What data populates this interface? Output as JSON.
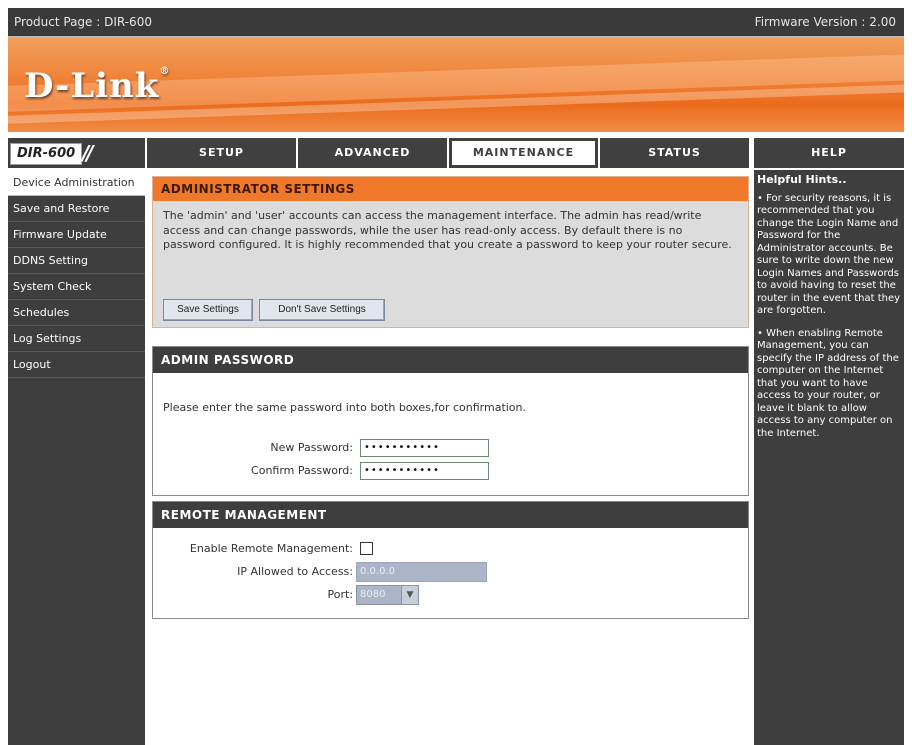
{
  "topbar": {
    "product": "Product Page : DIR-600",
    "firmware": "Firmware Version : 2.00"
  },
  "brand": {
    "logo": "D-Link",
    "trademark": "®",
    "model": "DIR-600"
  },
  "nav": {
    "tabs": [
      {
        "label": "SETUP"
      },
      {
        "label": "ADVANCED"
      },
      {
        "label": "MAINTENANCE",
        "active": true
      },
      {
        "label": "STATUS"
      },
      {
        "label": "HELP"
      }
    ]
  },
  "sidebar": {
    "items": [
      {
        "label": "Device Administration",
        "active": true
      },
      {
        "label": "Save and Restore"
      },
      {
        "label": "Firmware Update"
      },
      {
        "label": "DDNS Setting"
      },
      {
        "label": "System Check"
      },
      {
        "label": "Schedules"
      },
      {
        "label": "Log Settings"
      },
      {
        "label": "Logout"
      }
    ]
  },
  "admin": {
    "title": "ADMINISTRATOR SETTINGS",
    "description": "The 'admin' and 'user' accounts can access the management interface. The admin has read/write access and can change passwords, while the user has read-only access. By default there is no password configured. It is highly recommended that you create a password to keep your router secure.",
    "save_label": "Save Settings",
    "dont_save_label": "Don't Save Settings"
  },
  "password": {
    "title": "ADMIN PASSWORD",
    "intro": "Please enter the same password into both boxes,for confirmation.",
    "new_label": "New Password:",
    "new_value": "•••••••••••",
    "confirm_label": "Confirm Password:",
    "confirm_value": "•••••••••••"
  },
  "remote": {
    "title": "REMOTE MANAGEMENT",
    "enable_label": "Enable Remote Management:",
    "enabled": false,
    "ip_label": "IP Allowed to Access:",
    "ip_value": "0.0.0.0",
    "port_label": "Port:",
    "port_value": "8080"
  },
  "help": {
    "title": "Helpful Hints..",
    "hints": [
      "• For security reasons, it is recommended that you change the Login Name and Password for the Administrator accounts. Be sure to write down the new Login Names and Passwords to avoid having to reset the router in the event that they are forgotten.",
      "• When enabling Remote Management, you can specify the IP address of the computer on the Internet that you want to have access to your router, or leave it blank to allow access to any computer on the Internet."
    ]
  },
  "colors": {
    "accent_orange": "#f0782a",
    "dark_panel": "#3e3e3e",
    "disabled_field": "#aab6c8"
  }
}
